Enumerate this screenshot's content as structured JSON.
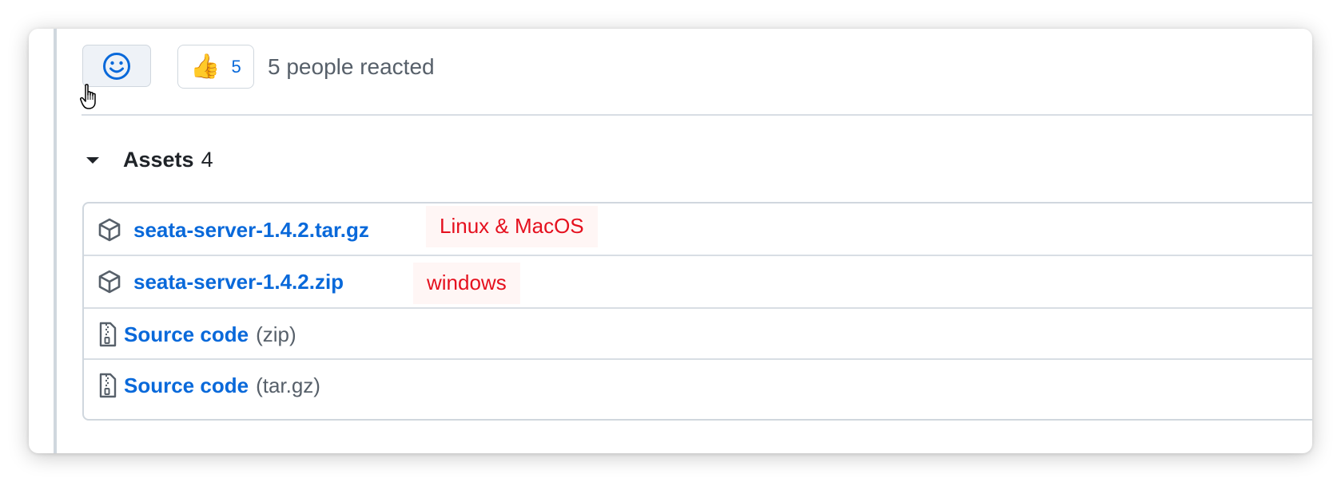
{
  "reactions": {
    "thumbs_emoji": "👍",
    "thumbs_count": "5",
    "summary": "5 people reacted",
    "add_reaction_icon": "smiley-icon"
  },
  "assets": {
    "title": "Assets",
    "count": "4",
    "items": [
      {
        "icon": "package-icon",
        "name": "seata-server-1.4.2.tar.gz",
        "suffix": "",
        "note": "Linux & MacOS"
      },
      {
        "icon": "package-icon",
        "name": "seata-server-1.4.2.zip",
        "suffix": "",
        "note": "windows"
      },
      {
        "icon": "file-zip-icon",
        "name": "Source code",
        "suffix": "(zip)",
        "note": ""
      },
      {
        "icon": "file-zip-icon",
        "name": "Source code",
        "suffix": "(tar.gz)",
        "note": ""
      }
    ]
  },
  "colors": {
    "link": "#0969da",
    "annotation": "#e5101e",
    "muted_text": "#57606a",
    "border": "#d0d7de"
  }
}
